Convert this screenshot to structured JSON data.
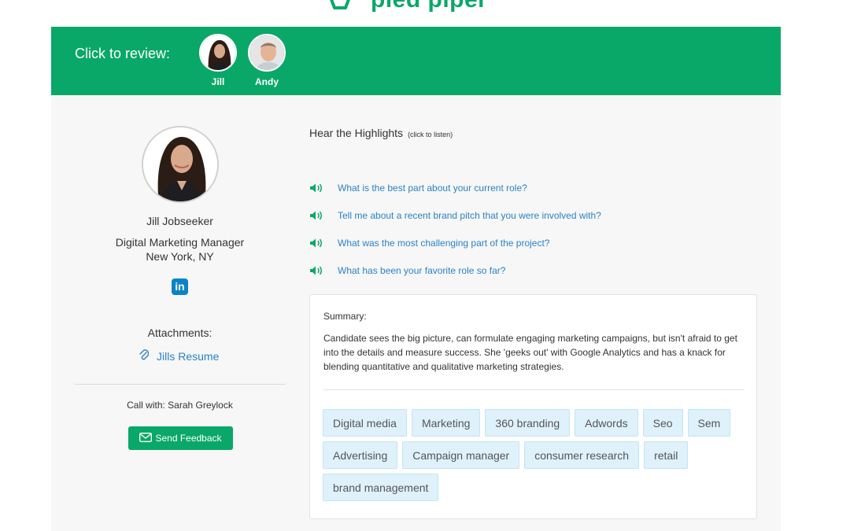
{
  "brand": {
    "name": "pied piper",
    "color": "#0aa868"
  },
  "banner": {
    "label": "Click to review:",
    "reviewers": [
      {
        "name": "Jill"
      },
      {
        "name": "Andy"
      }
    ]
  },
  "candidate": {
    "name": "Jill Jobseeker",
    "title": "Digital Marketing Manager",
    "location": "New York, NY",
    "linkedin_icon": "in",
    "attachments_label": "Attachments:",
    "attachment": "Jills Resume",
    "call_with": "Call with: Sarah Greylock",
    "feedback_button": "Send Feedback"
  },
  "highlights": {
    "title": "Hear the Highlights",
    "hint": "(click to listen)",
    "questions": [
      "What is the best part about your current role?",
      "Tell me about a recent brand pitch that you were involved with?",
      "What was the most challenging part of the project?",
      "What has been your favorite role so far?"
    ]
  },
  "summary": {
    "label": "Summary:",
    "text": "Candidate sees the big picture, can formulate engaging marketing campaigns, but isn't afraid to get into the details and measure success. She 'geeks out' with Google Analytics and has a knack for blending quantitative and qualitative marketing strategies.",
    "tags": [
      "Digital media",
      "Marketing",
      "360 branding",
      "Adwords",
      "Seo",
      "Sem",
      "Advertising",
      "Campaign manager",
      "consumer research",
      "retail",
      "brand management"
    ]
  },
  "colors": {
    "accent": "#0aa868",
    "link": "#2a82c8",
    "tag_bg": "#dff1fb"
  }
}
